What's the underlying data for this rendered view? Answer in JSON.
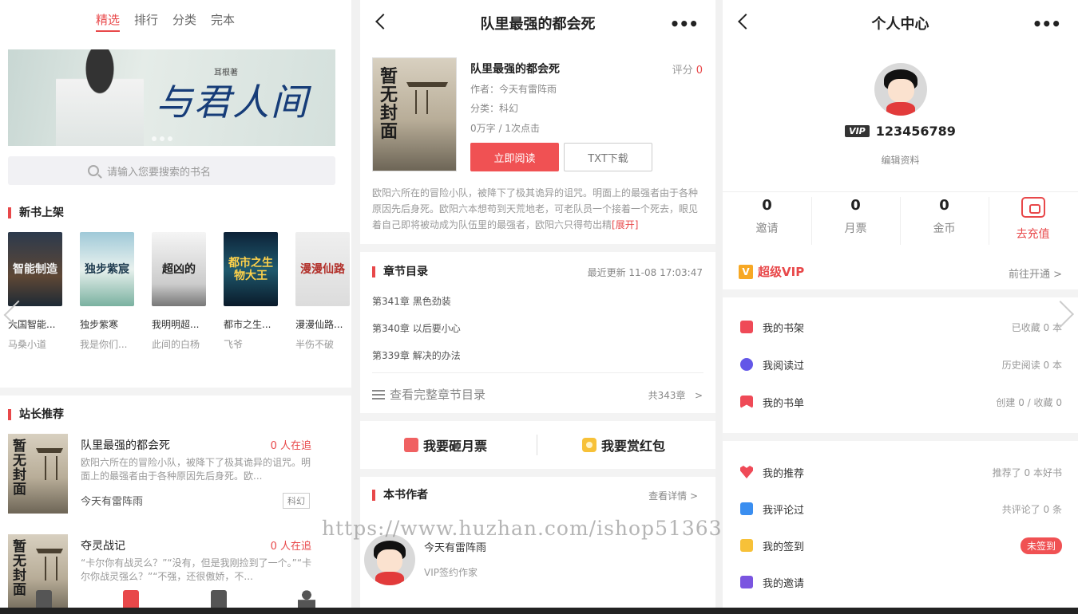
{
  "panel1": {
    "tabs": [
      "精选",
      "排行",
      "分类",
      "完本"
    ],
    "banner": {
      "title_art": "与君人间",
      "author_tag": "耳根著"
    },
    "search_placeholder": "请输入您要搜索的书名",
    "new_books_title": "新书上架",
    "new_books": [
      {
        "cover_text": "智能制造",
        "title": "大国智能...",
        "author": "马桑小道"
      },
      {
        "cover_text": "独步紫宸",
        "title": "独步紫寒",
        "author": "我是你们..."
      },
      {
        "cover_text": "超凶的",
        "title": "我明明超...",
        "author": "此间的白杨"
      },
      {
        "cover_text": "都市之生物大王",
        "title": "都市之生...",
        "author": "飞爷"
      },
      {
        "cover_text": "漫漫仙路",
        "title": "漫漫仙路...",
        "author": "半伤不破"
      }
    ],
    "recommend_title": "站长推荐",
    "recommend": [
      {
        "cover_text": "暂无封面",
        "title": "队里最强的都会死",
        "readers": "0 人在追",
        "desc": "欧阳六所在的冒险小队，被降下了极其诡异的诅咒。明面上的最强者由于各种原因先后身死。欧...",
        "author": "今天有雷阵雨",
        "genre": "科幻"
      },
      {
        "cover_text": "暂无封面",
        "title": "夺灵战记",
        "readers": "0 人在追",
        "desc": "“卡尔你有战灵么？”“没有，但是我刚捡到了一个。”“卡尔你战灵强么？”“不强，还很傲娇，不...",
        "author": "",
        "genre": ""
      }
    ]
  },
  "panel2": {
    "nav_title": "队里最强的都会死",
    "book": {
      "cover_text": "暂无封面",
      "title": "队里最强的都会死",
      "score_label": "评分",
      "score": "0",
      "author": "作者：今天有雷阵雨",
      "category": "分类：科幻",
      "stats": "0万字 / 1次点击",
      "read_btn": "立即阅读",
      "txt_btn": "TXT下载",
      "desc": "欧阳六所在的冒险小队，被降下了极其诡异的诅咒。明面上的最强者由于各种原因先后身死。欧阳六本想苟到天荒地老，可老队员一个接着一个死去，眼见着自己即将被动成为队伍里的最强者，欧阳六只得苟出精",
      "desc_more": "[展开]"
    },
    "chapters": {
      "title": "章节目录",
      "latest": "最近更新 11-08 17:03:47",
      "items": [
        "第341章 黑色劲装",
        "第340章 以后要小心",
        "第339章 解决的办法"
      ],
      "view_all": "查看完整章节目录",
      "total": "共343章",
      "arrow": ">"
    },
    "actions": {
      "ticket": "我要砸月票",
      "redpack": "我要赏红包"
    },
    "author_section": {
      "title": "本书作者",
      "detail": "查看详情 >",
      "name": "今天有雷阵雨",
      "tag": "VIP签约作家"
    },
    "watermark": "https://www.huzhan.com/ishop51363"
  },
  "panel3": {
    "nav_title": "个人中心",
    "vip_badge": "VIP",
    "user_id": "123456789",
    "edit_profile": "编辑资料",
    "stats": [
      {
        "num": "0",
        "label": "邀请"
      },
      {
        "num": "0",
        "label": "月票"
      },
      {
        "num": "0",
        "label": "金币"
      }
    ],
    "recharge": "去充值",
    "super_vip": {
      "icon": "V",
      "label": "超级VIP",
      "action": "前往开通 >"
    },
    "menu1": [
      {
        "icon": "shelf-icon",
        "label": "我的书架",
        "right": "已收藏 0 本"
      },
      {
        "icon": "clock-icon",
        "label": "我阅读过",
        "right": "历史阅读 0 本"
      },
      {
        "icon": "booklist-icon",
        "label": "我的书单",
        "right": "创建 0 / 收藏 0"
      }
    ],
    "menu2": [
      {
        "icon": "heart-icon",
        "label": "我的推荐",
        "right": "推荐了 0 本好书"
      },
      {
        "icon": "comment-icon",
        "label": "我评论过",
        "right": "共评论了 0 条"
      },
      {
        "icon": "checkin-icon",
        "label": "我的签到",
        "badge": "未签到"
      },
      {
        "icon": "invite-icon",
        "label": "我的邀请",
        "right": ""
      }
    ]
  },
  "colors": {
    "accent": "#e8484a",
    "read_button": "#f05153",
    "vip_gold": "#f7a824"
  }
}
